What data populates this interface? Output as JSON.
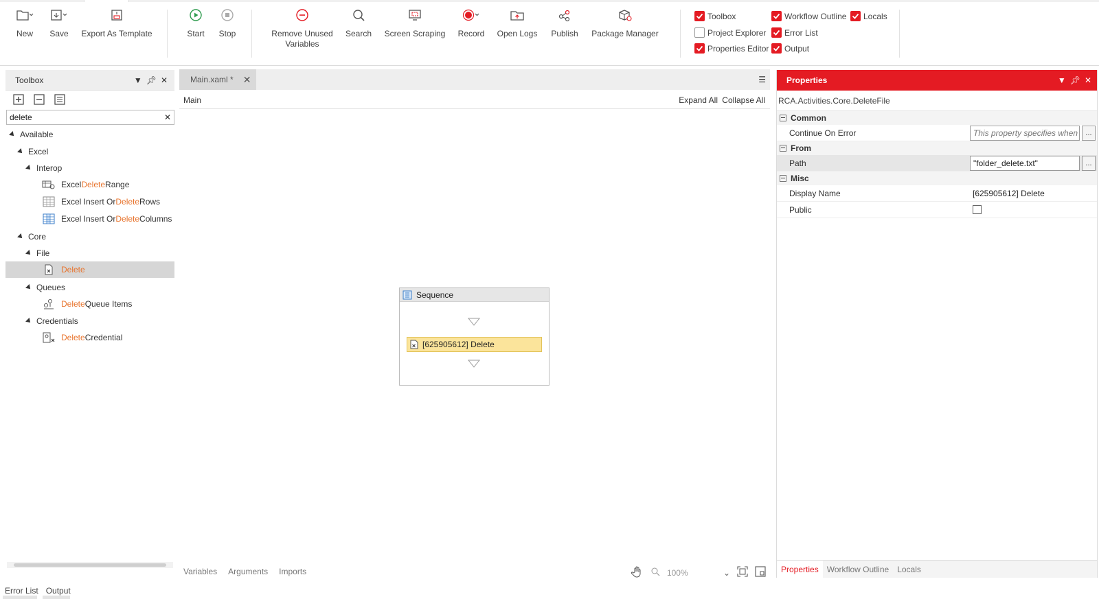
{
  "ribbon": {
    "buttons": {
      "new": "New",
      "save": "Save",
      "export_template": "Export As Template",
      "start": "Start",
      "stop": "Stop",
      "remove_unused_1": "Remove Unused",
      "remove_unused_2": "Variables",
      "search": "Search",
      "screen_scraping": "Screen Scraping",
      "record": "Record",
      "open_logs": "Open Logs",
      "publish": "Publish",
      "package_manager": "Package Manager"
    },
    "panels": {
      "toolbox": {
        "label": "Toolbox",
        "checked": true
      },
      "workflow_outline": {
        "label": "Workflow Outline",
        "checked": true
      },
      "locals": {
        "label": "Locals",
        "checked": true
      },
      "project_explorer": {
        "label": "Project Explorer",
        "checked": false
      },
      "error_list": {
        "label": "Error List",
        "checked": true
      },
      "properties_editor": {
        "label": "Properties Editor",
        "checked": true
      },
      "output": {
        "label": "Output",
        "checked": true
      }
    }
  },
  "toolbox": {
    "title": "Toolbox",
    "search_value": "delete",
    "tree": {
      "available": "Available",
      "excel": "Excel",
      "interop": "Interop",
      "excel_delete_range": {
        "pre": "Excel ",
        "hl": "Delete",
        "post": " Range"
      },
      "excel_insert_delete_rows": {
        "pre": "Excel Insert Or ",
        "hl": "Delete",
        "post": " Rows"
      },
      "excel_insert_delete_columns": {
        "pre": "Excel Insert Or ",
        "hl": "Delete",
        "post": " Columns"
      },
      "core": "Core",
      "file": "File",
      "delete": {
        "pre": "",
        "hl": "Delete",
        "post": ""
      },
      "queues": "Queues",
      "delete_queue_items": {
        "pre": "",
        "hl": "Delete",
        "post": " Queue Items"
      },
      "credentials": "Credentials",
      "delete_credential": {
        "pre": "",
        "hl": "Delete",
        "post": " Credential"
      }
    }
  },
  "designer": {
    "tab": "Main.xaml *",
    "breadcrumb": "Main",
    "expand_all": "Expand All",
    "collapse_all": "Collapse All",
    "sequence_title": "Sequence",
    "activity": "[625905612] Delete",
    "footer": {
      "variables": "Variables",
      "arguments": "Arguments",
      "imports": "Imports",
      "zoom": "100%"
    }
  },
  "properties": {
    "title": "Properties",
    "type": "RCA.Activities.Core.DeleteFile",
    "categories": {
      "common": "Common",
      "from": "From",
      "misc": "Misc"
    },
    "rows": {
      "continue_on_error": {
        "name": "Continue On Error",
        "placeholder": "This property specifies when t"
      },
      "path": {
        "name": "Path",
        "value": "\"folder_delete.txt\""
      },
      "display_name": {
        "name": "Display Name",
        "value": "[625905612] Delete"
      },
      "public": {
        "name": "Public",
        "checked": false
      }
    },
    "tabs": {
      "properties": "Properties",
      "workflow_outline": "Workflow Outline",
      "locals": "Locals"
    }
  },
  "bottom_tabs": {
    "error_list": "Error List",
    "output": "Output"
  },
  "colors": {
    "accent": "#e41b23",
    "highlight": "#e8732c",
    "activity_fill": "#fbe49b"
  }
}
